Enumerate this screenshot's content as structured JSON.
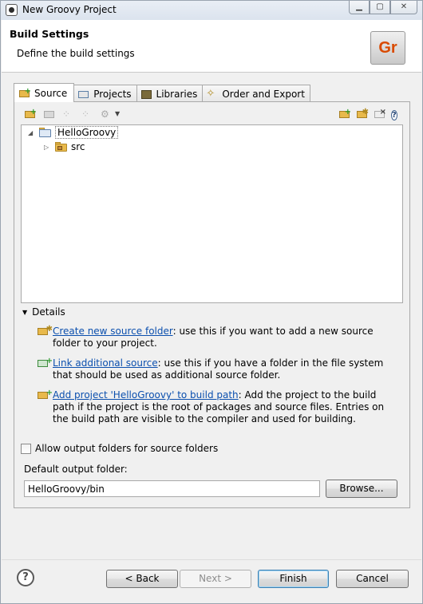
{
  "window": {
    "title": "New Groovy Project",
    "controls": [
      "▁",
      "▢",
      "✕"
    ]
  },
  "header": {
    "title": "Build Settings",
    "description": "Define the build settings",
    "logo_text": "Gr"
  },
  "tabs": [
    {
      "label": "Source",
      "icon": "source-icon",
      "active": true
    },
    {
      "label": "Projects",
      "icon": "projects-icon",
      "active": false
    },
    {
      "label": "Libraries",
      "icon": "libraries-icon",
      "active": false
    },
    {
      "label": "Order and Export",
      "icon": "order-export-icon",
      "active": false
    }
  ],
  "tree": {
    "root": {
      "label": "HelloGroovy",
      "expanded": true
    },
    "child": {
      "label": "src",
      "expanded": false
    }
  },
  "details": {
    "heading": "Details",
    "items": [
      {
        "link": "Create new source folder",
        "text": ": use this if you want to add a new source folder to your project."
      },
      {
        "link": "Link additional source",
        "text": ": use this if you have a folder in the file system that should be used as additional source folder."
      },
      {
        "link": "Add project 'HelloGroovy' to build path",
        "text": ": Add the project to the build path if the project is the root of packages and source files. Entries on the build path are visible to the compiler and used for building."
      }
    ]
  },
  "options": {
    "allow_output_folders_label": "Allow output folders for source folders",
    "allow_output_folders_checked": false
  },
  "output": {
    "label": "Default output folder:",
    "value": "HelloGroovy/bin",
    "browse_label": "Browse..."
  },
  "footer": {
    "help": "?",
    "back_label": "< Back",
    "next_label": "Next >",
    "finish_label": "Finish",
    "cancel_label": "Cancel"
  },
  "colors": {
    "link": "#0b4fae",
    "folder": "#e8b94b",
    "logo_text": "#d94a00"
  }
}
